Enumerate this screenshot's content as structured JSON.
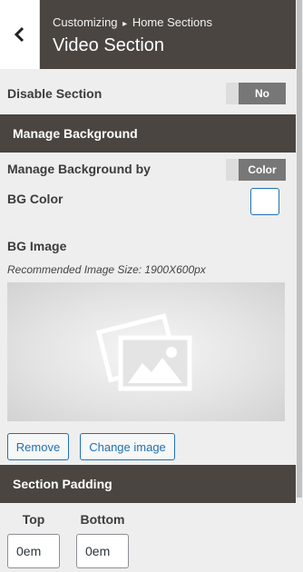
{
  "header": {
    "breadcrumb_prefix": "Customizing",
    "breadcrumb_separator": "▸",
    "breadcrumb_section": "Home Sections",
    "title": "Video Section"
  },
  "disable_section": {
    "label": "Disable Section",
    "toggle_value": "No"
  },
  "manage_background": {
    "heading": "Manage Background",
    "by_label": "Manage Background by",
    "by_value": "Color",
    "bg_color_label": "BG Color",
    "bg_color_value": "#ffffff",
    "bg_image_label": "BG Image",
    "bg_image_note": "Recommended Image Size: 1900X600px",
    "remove_label": "Remove",
    "change_image_label": "Change image"
  },
  "section_padding": {
    "heading": "Section Padding",
    "top_label": "Top",
    "top_value": "0em",
    "bottom_label": "Bottom",
    "bottom_value": "0em"
  },
  "colors": {
    "header_bg": "#4a4541",
    "accent": "#2271b1",
    "toggle_on": "#777777"
  },
  "icons": {
    "back": "chevron-left-icon",
    "image_placeholder": "images-icon"
  }
}
